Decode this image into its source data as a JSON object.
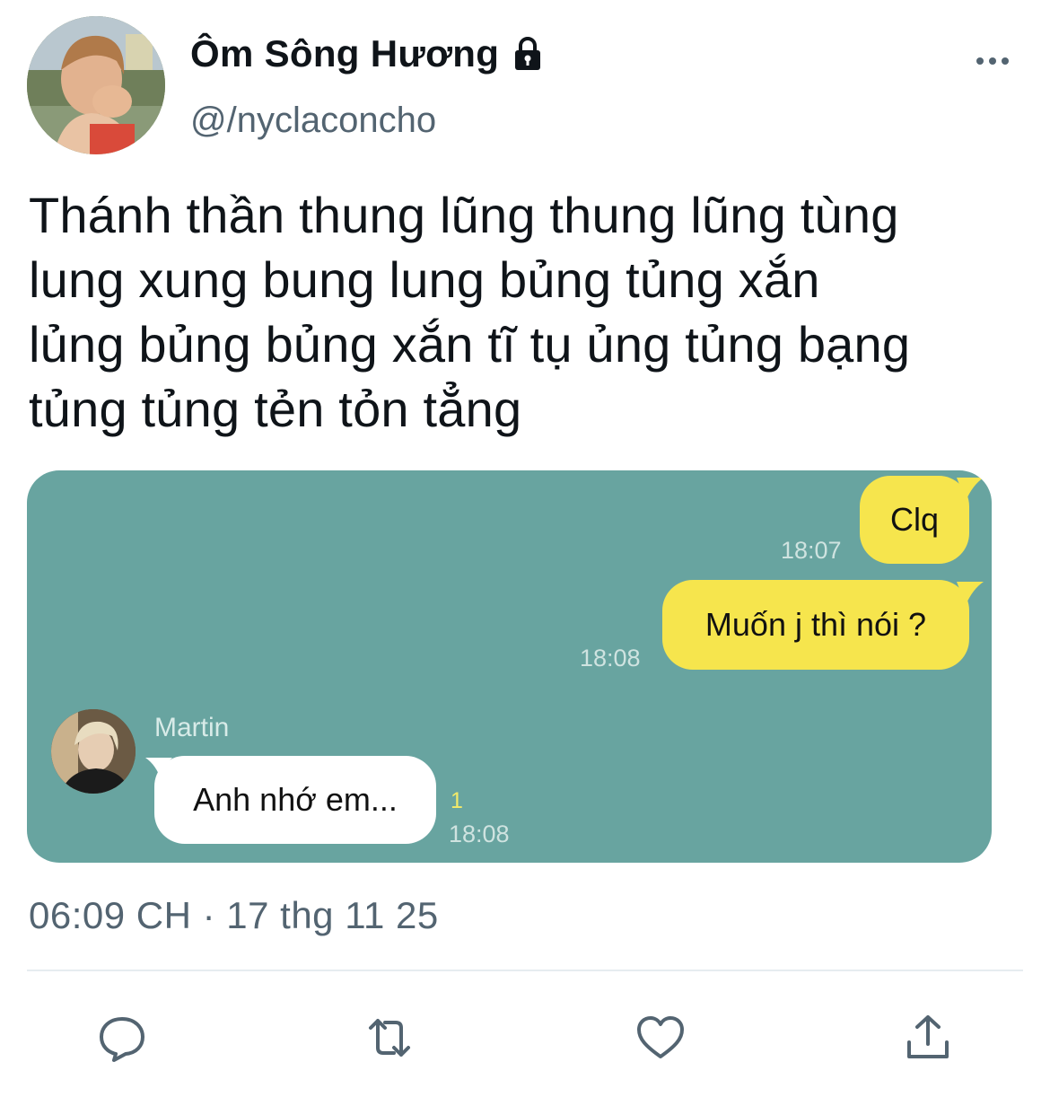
{
  "tweet": {
    "display_name": "Ôm Sông Hương",
    "handle": "@/nyclaconcho",
    "text_lines": [
      "Thánh thần thung lũng thung lũng tùng",
      "lung xung bung lung bủng tủng xắn",
      "lủng bủng bủng xắn tĩ tụ ủng tủng bạng",
      "tủng tủng tẻn tỏn tẳng"
    ],
    "timestamp": "06:09 CH · 17 thg 11 25"
  },
  "chat": {
    "messages": [
      {
        "text": "Clq",
        "time": "18:07"
      },
      {
        "text": "Muốn j thì nói ?",
        "time": "18:08"
      },
      {
        "sender": "Martin",
        "text": "Anh nhớ em...",
        "time": "18:08",
        "unread": "1"
      }
    ]
  },
  "icons": {
    "verified_lock": "lock-icon",
    "more": "more-icon",
    "reply": "reply-icon",
    "retweet": "retweet-icon",
    "like": "heart-icon",
    "share": "share-icon"
  },
  "colors": {
    "chat_background": "#68a4a0",
    "my_bubble": "#f6e54d",
    "their_bubble": "#ffffff",
    "secondary_text": "#536471"
  }
}
